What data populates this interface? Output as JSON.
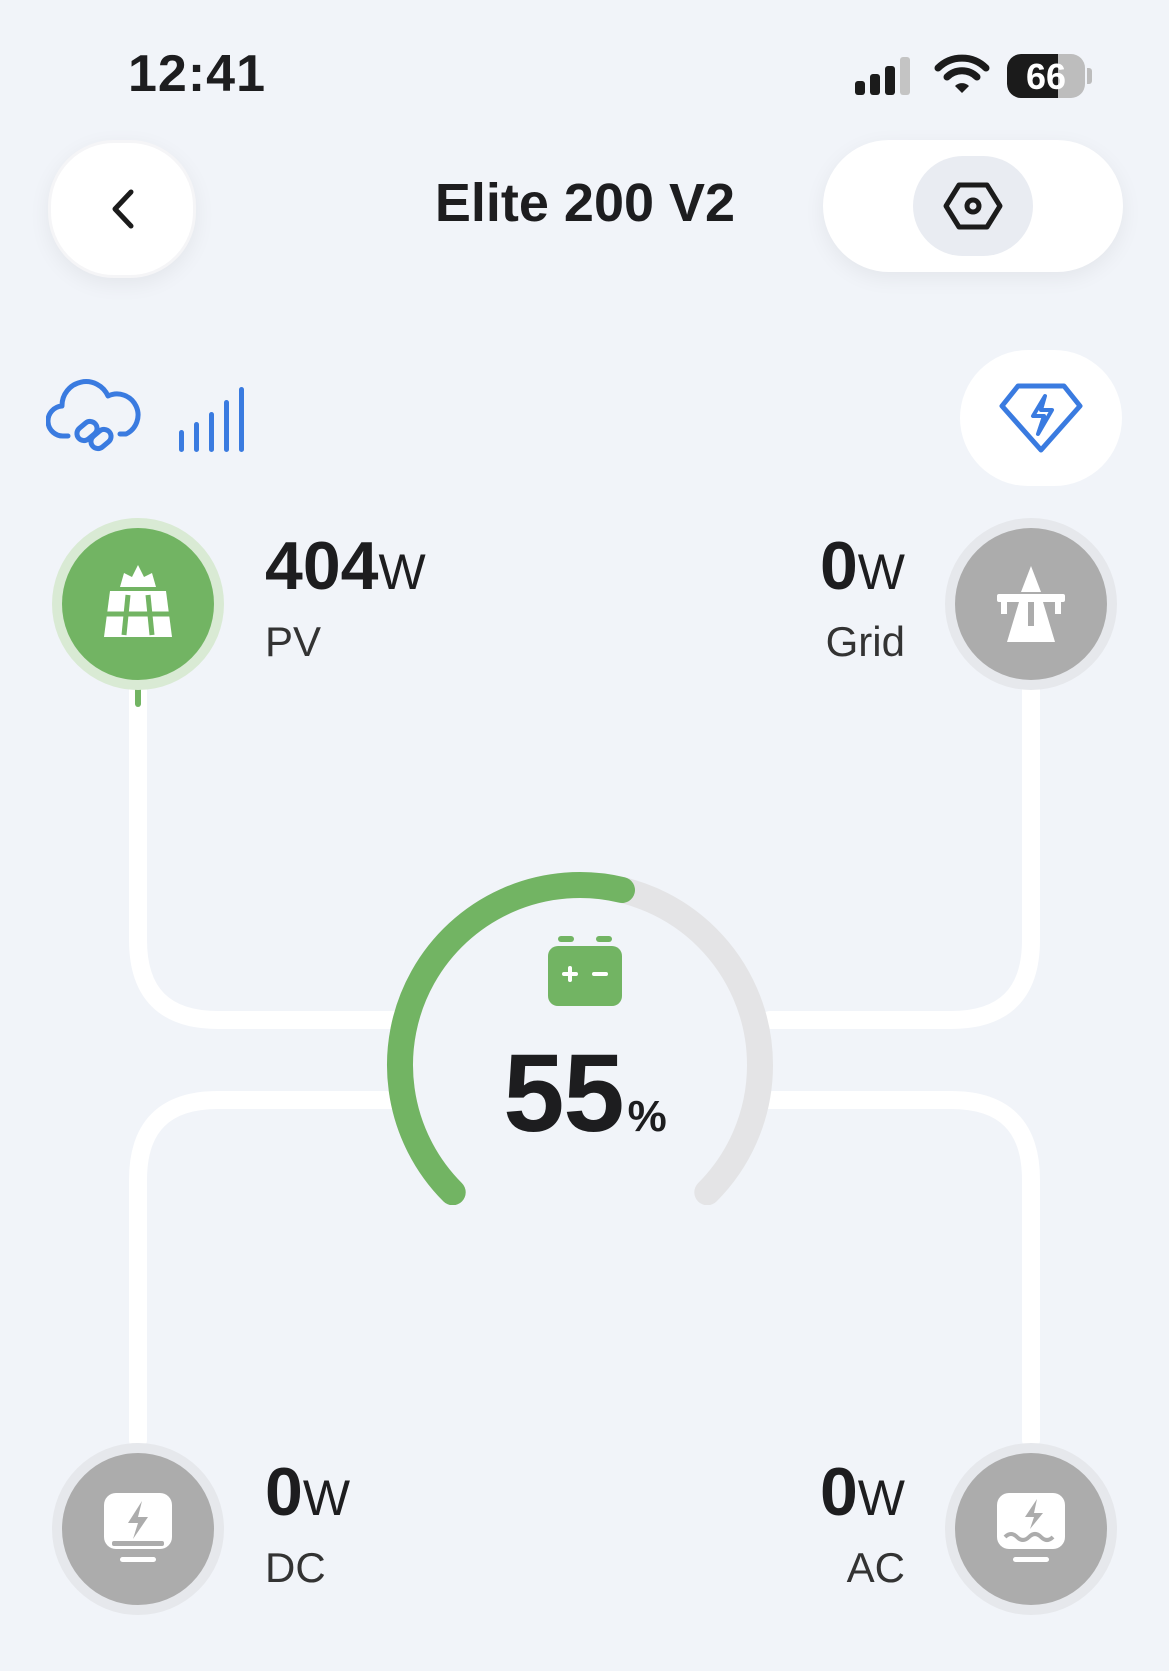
{
  "status_bar": {
    "time": "12:41",
    "battery_level": "66",
    "battery_fraction": 0.66
  },
  "header": {
    "title": "Elite 200 V2",
    "back_icon": "chevron-left-icon",
    "settings_icon": "hex-settings-icon"
  },
  "connectivity": {
    "cloud_icon": "cloud-link-icon",
    "signal_icon": "signal-bars-icon",
    "accent": "#3a7be0"
  },
  "premium_icon": "diamond-bolt-icon",
  "flow": {
    "pv": {
      "value": "404",
      "unit": "W",
      "label": "PV",
      "icon": "solar-panel-icon"
    },
    "grid": {
      "value": "0",
      "unit": "W",
      "label": "Grid",
      "icon": "power-tower-icon"
    },
    "dc": {
      "value": "0",
      "unit": "W",
      "label": "DC",
      "icon": "dc-output-icon"
    },
    "ac": {
      "value": "0",
      "unit": "W",
      "label": "AC",
      "icon": "ac-output-icon"
    }
  },
  "battery": {
    "soc": "55",
    "soc_unit": "%",
    "soc_fraction": 0.55,
    "icon": "battery-icon"
  },
  "colors": {
    "active_green": "#72b463",
    "inactive_gray": "#acacac",
    "background": "#f1f4f9"
  }
}
